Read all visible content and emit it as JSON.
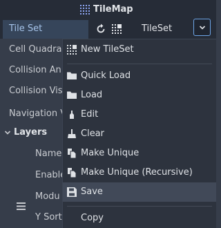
{
  "header": {
    "title": "TileMap",
    "icon": "tilemap-icon"
  },
  "tileset": {
    "label": "Tile Set",
    "value": "TileSet",
    "revert_icon": "revert-icon",
    "value_icon": "tileset-icon",
    "dropdown_icon": "chevron-down-icon"
  },
  "properties": [
    {
      "label": "Cell Quadra"
    },
    {
      "label": "Collision An"
    },
    {
      "label": "Collision Vis"
    },
    {
      "label": "Navigation V"
    }
  ],
  "layers": {
    "label": "Layers",
    "items": [
      {
        "label": "Name"
      },
      {
        "label": "Enable"
      },
      {
        "label": "Modu"
      },
      {
        "label": "Y Sort"
      }
    ]
  },
  "menu": {
    "items": [
      {
        "label": "New TileSet",
        "icon": "tileset-icon"
      },
      {
        "label": "Quick Load",
        "icon": "folder-icon"
      },
      {
        "label": "Load",
        "icon": "folder-icon"
      },
      {
        "label": "Edit",
        "icon": "edit-icon"
      },
      {
        "label": "Clear",
        "icon": "broom-icon"
      },
      {
        "label": "Make Unique",
        "icon": "duplicate-icon"
      },
      {
        "label": "Make Unique (Recursive)",
        "icon": "duplicate-icon"
      },
      {
        "label": "Save",
        "icon": "save-icon"
      },
      {
        "label": "Copy",
        "icon": ""
      }
    ]
  },
  "colors": {
    "background": "#363d4a",
    "header": "#262c37",
    "label_highlight": "#a6c4ea",
    "accent_border": "#6ea6e8",
    "menu_bg": "#2d333e",
    "menu_hover": "#414958"
  }
}
